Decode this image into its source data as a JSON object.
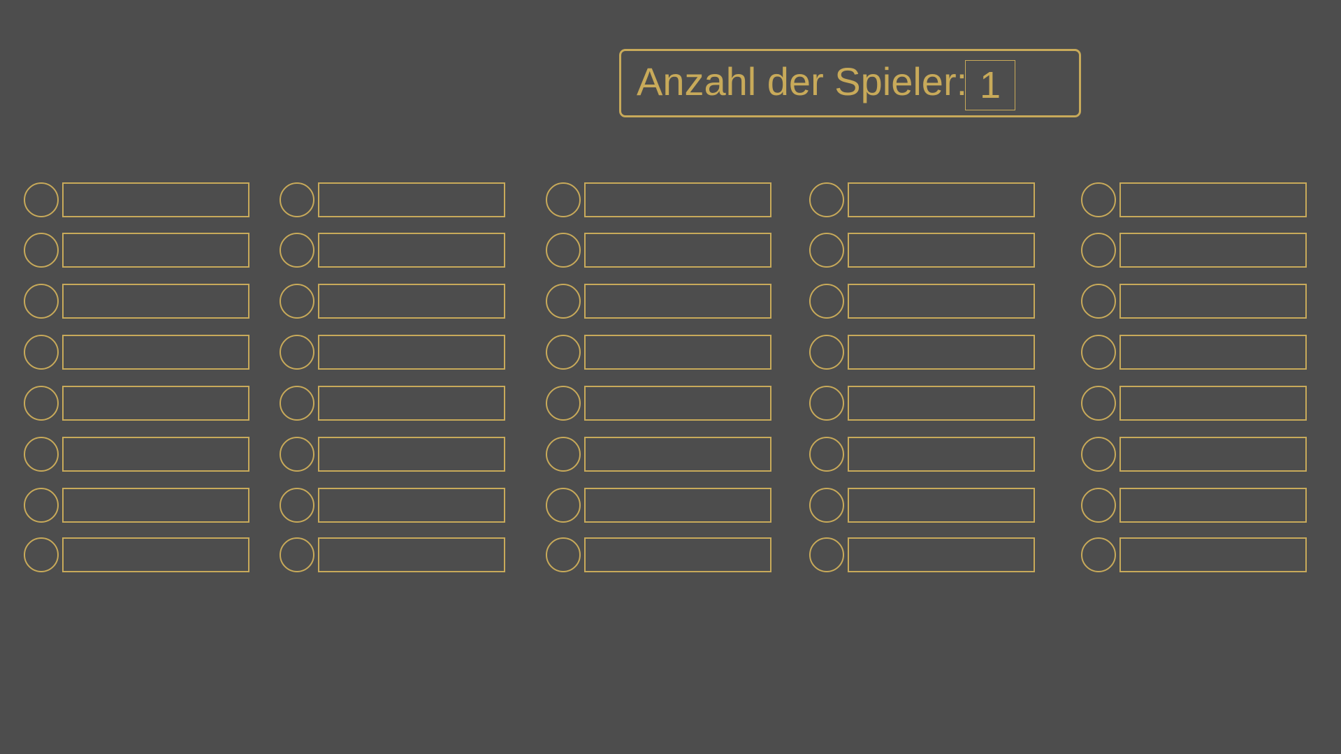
{
  "header": {
    "player_count_label": "Anzahl der Spieler:",
    "player_count_value": "1"
  },
  "theme": {
    "background": "#4d4d4d",
    "accent": "#c8aa5a"
  },
  "columns": [
    {
      "slots": [
        {
          "name": ""
        },
        {
          "name": ""
        },
        {
          "name": ""
        },
        {
          "name": ""
        },
        {
          "name": ""
        },
        {
          "name": ""
        },
        {
          "name": ""
        },
        {
          "name": ""
        }
      ]
    },
    {
      "slots": [
        {
          "name": ""
        },
        {
          "name": ""
        },
        {
          "name": ""
        },
        {
          "name": ""
        },
        {
          "name": ""
        },
        {
          "name": ""
        },
        {
          "name": ""
        },
        {
          "name": ""
        }
      ]
    },
    {
      "slots": [
        {
          "name": ""
        },
        {
          "name": ""
        },
        {
          "name": ""
        },
        {
          "name": ""
        },
        {
          "name": ""
        },
        {
          "name": ""
        },
        {
          "name": ""
        },
        {
          "name": ""
        }
      ]
    },
    {
      "slots": [
        {
          "name": ""
        },
        {
          "name": ""
        },
        {
          "name": ""
        },
        {
          "name": ""
        },
        {
          "name": ""
        },
        {
          "name": ""
        },
        {
          "name": ""
        },
        {
          "name": ""
        }
      ]
    },
    {
      "slots": [
        {
          "name": ""
        },
        {
          "name": ""
        },
        {
          "name": ""
        },
        {
          "name": ""
        },
        {
          "name": ""
        },
        {
          "name": ""
        },
        {
          "name": ""
        },
        {
          "name": ""
        }
      ]
    }
  ]
}
